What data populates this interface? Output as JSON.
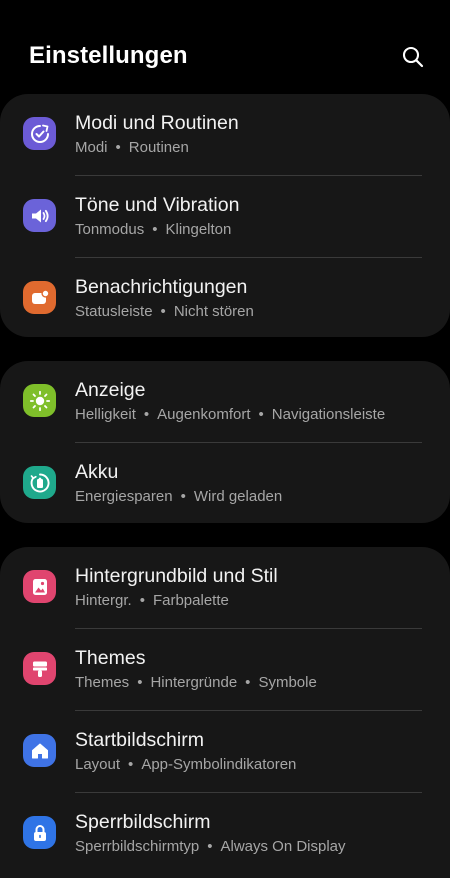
{
  "header": {
    "title": "Einstellungen",
    "search_icon": "search-icon"
  },
  "groups": [
    {
      "items": [
        {
          "title": "Modi und Routinen",
          "subtitle": [
            "Modi",
            "Routinen"
          ],
          "icon": "routines-icon",
          "color": "#6c5bd6"
        },
        {
          "title": "Töne und Vibration",
          "subtitle": [
            "Tonmodus",
            "Klingelton"
          ],
          "icon": "sound-icon",
          "color": "#6b63d9"
        },
        {
          "title": "Benachrichtigungen",
          "subtitle": [
            "Statusleiste",
            "Nicht stören"
          ],
          "icon": "notifications-icon",
          "color": "#e06a2f"
        }
      ]
    },
    {
      "items": [
        {
          "title": "Anzeige",
          "subtitle": [
            "Helligkeit",
            "Augenkomfort",
            "Navigationsleiste"
          ],
          "icon": "display-icon",
          "color": "#7fbf2a"
        },
        {
          "title": "Akku",
          "subtitle": [
            "Energiesparen",
            "Wird geladen"
          ],
          "icon": "battery-icon",
          "color": "#1fa98c"
        }
      ]
    },
    {
      "items": [
        {
          "title": "Hintergrundbild und Stil",
          "subtitle": [
            "Hintergr.",
            "Farbpalette"
          ],
          "icon": "wallpaper-icon",
          "color": "#e0456f"
        },
        {
          "title": "Themes",
          "subtitle": [
            "Themes",
            "Hintergründe",
            "Symbole"
          ],
          "icon": "themes-icon",
          "color": "#e0456f"
        },
        {
          "title": "Startbildschirm",
          "subtitle": [
            "Layout",
            "App-Symbolindikatoren"
          ],
          "icon": "home-icon",
          "color": "#3f73e6"
        },
        {
          "title": "Sperrbildschirm",
          "subtitle": [
            "Sperrbildschirmtyp",
            "Always On Display"
          ],
          "icon": "lock-icon",
          "color": "#2f74e6"
        }
      ]
    }
  ]
}
